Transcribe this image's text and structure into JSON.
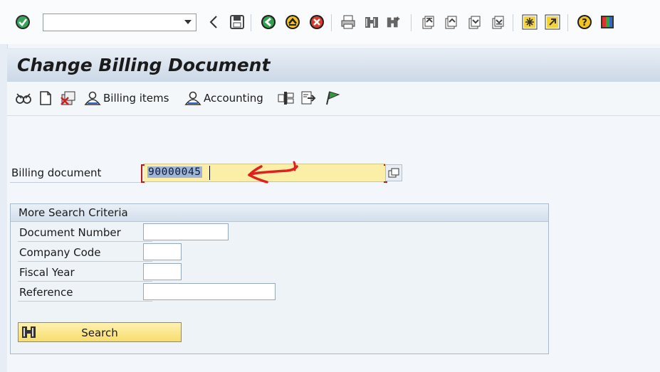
{
  "system_toolbar": {
    "command_field_value": "",
    "icons": [
      "enter-icon",
      "back-icon",
      "save-icon",
      "back-nav-icon",
      "exit-icon",
      "cancel-icon",
      "print-icon",
      "find-icon",
      "find-next-icon",
      "first-page-icon",
      "previous-page-icon",
      "next-page-icon",
      "last-page-icon",
      "create-session-icon",
      "shortcut-icon",
      "help-icon",
      "customize-layout-icon"
    ]
  },
  "title": "Change Billing Document",
  "app_toolbar": {
    "billing_items_label": "Billing items",
    "accounting_label": "Accounting",
    "icons": [
      "display-change-icon",
      "new-document-icon",
      "cancel-document-icon",
      "billing-items-icon",
      "accounting-icon",
      "output-icon",
      "release-icon",
      "flag-icon"
    ]
  },
  "form": {
    "billing_document_label": "Billing document",
    "billing_document_value": "90000045"
  },
  "search_group": {
    "title": "More Search Criteria",
    "fields": [
      {
        "label": "Document Number",
        "value": ""
      },
      {
        "label": "Company Code",
        "value": ""
      },
      {
        "label": "Fiscal Year",
        "value": ""
      },
      {
        "label": "Reference",
        "value": ""
      }
    ],
    "search_button_label": "Search"
  },
  "colors": {
    "required_field": "#fbefa8",
    "search_button": "#f8dc6c",
    "annotation_arrow": "#e02020",
    "title_bar": "#cbd8e6"
  }
}
